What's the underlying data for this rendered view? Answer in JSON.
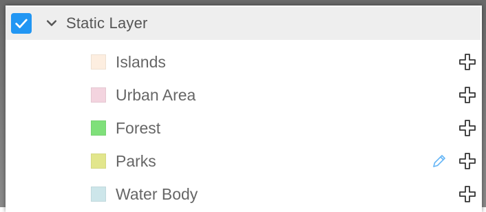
{
  "colors": {
    "accent": "#2196f3",
    "header_bg": "#eeeeee",
    "edit_icon": "#64b5f6"
  },
  "layer": {
    "checked": true,
    "expanded": true,
    "title": "Static Layer",
    "checkbox_icon": "checkmark-icon",
    "toggle_icon": "chevron-down-icon"
  },
  "items": [
    {
      "label": "Islands",
      "swatch_color": "#fdeee0",
      "icons": [
        "plus-outline-icon"
      ]
    },
    {
      "label": "Urban Area",
      "swatch_color": "#f3d4df",
      "icons": [
        "plus-outline-icon"
      ]
    },
    {
      "label": "Forest",
      "swatch_color": "#7fe07a",
      "icons": [
        "plus-outline-icon"
      ]
    },
    {
      "label": "Parks",
      "swatch_color": "#e2e68c",
      "icons": [
        "pencil-icon",
        "plus-outline-icon"
      ]
    },
    {
      "label": "Water Body",
      "swatch_color": "#cde6ea",
      "icons": [
        "plus-outline-icon"
      ]
    }
  ]
}
